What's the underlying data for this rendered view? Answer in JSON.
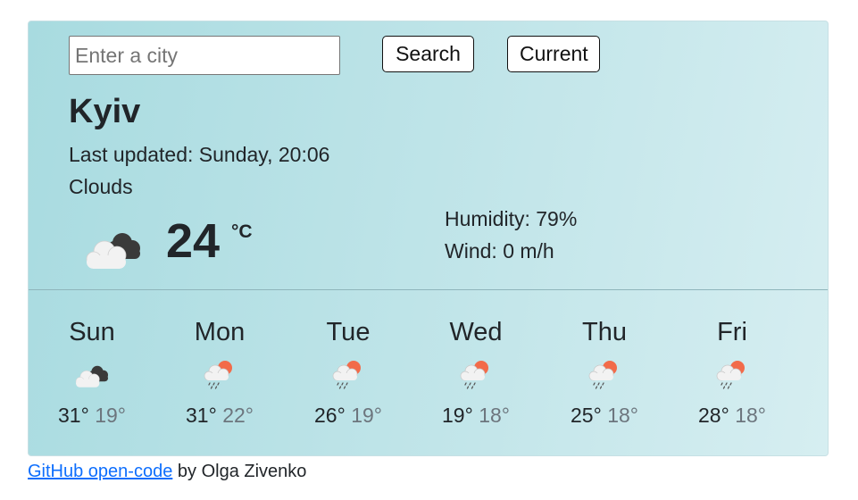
{
  "search": {
    "placeholder": "Enter a city",
    "value": "",
    "search_label": "Search",
    "current_label": "Current"
  },
  "current": {
    "city": "Kyiv",
    "last_updated_label": "Last updated:",
    "last_updated": "Sunday, 20:06",
    "description": "Clouds",
    "temperature": "24",
    "unit": "°C",
    "humidity_label": "Humidity:",
    "humidity": "79%",
    "wind_label": "Wind:",
    "wind": "0 m/h",
    "icon": "broken-clouds-icon"
  },
  "forecast": [
    {
      "day": "Sun",
      "max": "31°",
      "min": "19°",
      "icon": "broken-clouds-icon"
    },
    {
      "day": "Mon",
      "max": "31°",
      "min": "22°",
      "icon": "rain-sun-icon"
    },
    {
      "day": "Tue",
      "max": "26°",
      "min": "19°",
      "icon": "rain-sun-icon"
    },
    {
      "day": "Wed",
      "max": "19°",
      "min": "18°",
      "icon": "rain-sun-icon"
    },
    {
      "day": "Thu",
      "max": "25°",
      "min": "18°",
      "icon": "rain-sun-icon"
    },
    {
      "day": "Fri",
      "max": "28°",
      "min": "18°",
      "icon": "rain-sun-icon"
    }
  ],
  "footer": {
    "link_text": "GitHub open-code",
    "by_text": " by Olga Zivenko"
  },
  "colors": {
    "card_gradient_start": "#a8dbe0",
    "card_gradient_end": "#d6eef1",
    "sun": "#f26b4a",
    "cloud_dark": "#3a3a3a",
    "cloud_light": "#f2f2f2",
    "link": "#0d6efd"
  }
}
